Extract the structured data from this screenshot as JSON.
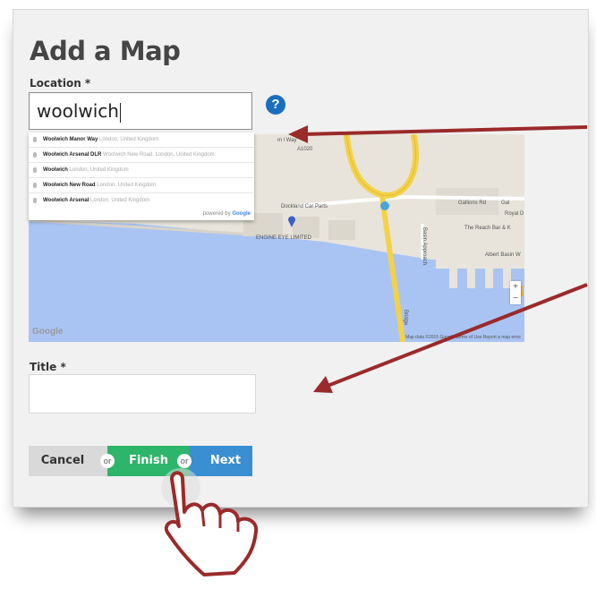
{
  "form": {
    "title": "Add a Map",
    "location_label": "Location *",
    "location_value": "woolwich",
    "help_icon": "?",
    "title_label": "Title *",
    "title_value": ""
  },
  "autocomplete": {
    "items": [
      {
        "main": "Woolwich Manor Way",
        "secondary": "London, United Kingdom"
      },
      {
        "main": "Woolwich Arsenal DLR",
        "secondary": "Woolwich New Road, London, United Kingdom"
      },
      {
        "main": "Woolwich",
        "secondary": "London, United Kingdom"
      },
      {
        "main": "Woolwich New Road",
        "secondary": "London, United Kingdom"
      },
      {
        "main": "Woolwich Arsenal",
        "secondary": "London, United Kingdom"
      }
    ],
    "powered_by": "powered by",
    "powered_brand": "Google"
  },
  "map": {
    "labels": {
      "road": "A1020",
      "way": "m l Way",
      "dockland": "Dockland Car Parts",
      "engine": "ENGINE EYE LIMITED",
      "gallions": "Gallions Rd",
      "gal": "Gal",
      "royal": "Royal D",
      "reach": "The Reach Bar & K",
      "albert": "Albert Basin W",
      "approach": "Basin Approach",
      "bridge": "Bridge"
    },
    "logo": "Google",
    "footer": "Map data ©2015 Google   Terms of Use   Report a map error",
    "zoom_in": "+",
    "zoom_out": "−"
  },
  "buttons": {
    "cancel": "Cancel",
    "or1": "or",
    "finish": "Finish",
    "or2": "or",
    "next": "Next"
  },
  "colors": {
    "finish": "#2db56b",
    "next": "#3a8ed2",
    "arrow": "#9b2a2a",
    "help": "#1a6ec0"
  },
  "icons": [
    "help-icon",
    "location-pin-icon",
    "pegman-icon",
    "hand-pointer-icon",
    "arrow-icon"
  ]
}
